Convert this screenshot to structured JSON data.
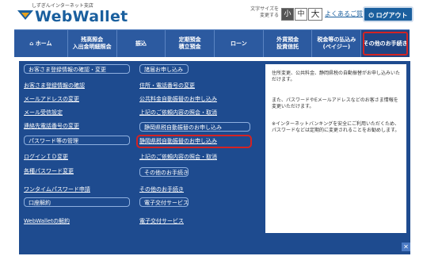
{
  "header": {
    "logo_sub": "しずぎんインターネット支店",
    "logo_text": "WebWallet",
    "size_label_1": "文字サイズを",
    "size_label_2": "変更する",
    "size_small": "小",
    "size_medium": "中",
    "size_large": "大",
    "faq": "よくあるご質問",
    "logout": "ログアウト"
  },
  "nav": {
    "home": "ホーム",
    "balance_1": "残高照会",
    "balance_2": "入出金明細照会",
    "transfer": "振込",
    "fixed_1": "定期預金",
    "fixed_2": "積立預金",
    "loan": "ローン",
    "fx_1": "外貨預金",
    "fx_2": "投資信託",
    "tax_1": "税金等の払込み",
    "tax_2": "(ペイジー)",
    "other": "その他のお手続き"
  },
  "menu_left": [
    "お客さま登録情報の確認・変更",
    "お客さま登録情報の確認",
    "メールアドレスの変更",
    "メール受信設定",
    "連絡先電話番号の変更",
    "パスワード等の管理",
    "ログインＩＤ変更",
    "各種パスワード変更",
    "ワンタイムパスワード申請",
    "口座解約",
    "WebWalletの解約"
  ],
  "menu_mid": [
    "諸届お申し込み",
    "住所・電話番号の変更",
    "公共料金自動振替のお申し込み",
    "上記のご依頼内容の照会・取消",
    "静岡県税自動振替のお申し込み",
    "静岡県税自動振替のお申し込み",
    "上記のご依頼内容の照会・取消",
    "その他のお手続き",
    "その他のお手続き",
    "電子交付サービス",
    "電子交付サービス"
  ],
  "info": {
    "p1": "住所変更、公共料金、静岡県税の自動振替がお申し込みいただけます。",
    "p2": "また、パスワードやEメールアドレスなどのお客さま情報を変更いただけます。",
    "p3": "※インターネットバンキングを安全にご利用いただくため、パスワードなどは定期的に変更されることをお勧めします。"
  },
  "close": "✕",
  "colors": {
    "nav": "#2c5aa0",
    "dropdown": "#1e4b8f",
    "highlight": "#d42323",
    "brand": "#1a5f9e"
  }
}
